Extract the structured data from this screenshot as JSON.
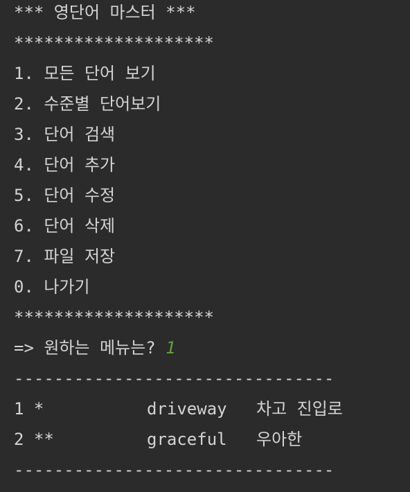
{
  "console": {
    "header_title": "*** 영단어 마스터 ***",
    "stars_top": "********************",
    "menu": [
      "1. 모든 단어 보기",
      "2. 수준별 단어보기",
      "3. 단어 검색",
      "4. 단어 추가",
      "5. 단어 수정",
      "6. 단어 삭제",
      "7. 파일 저장",
      "0. 나가기"
    ],
    "stars_bottom": "********************",
    "prompt": "=> 원하는 메뉴는? ",
    "input_value": "1",
    "divider_top": "--------------------------------",
    "words": [
      {
        "index_level": "1 *",
        "word": "driveway",
        "meaning": "차고 진입로"
      },
      {
        "index_level": "2 **",
        "word": "graceful",
        "meaning": "우아한"
      }
    ],
    "divider_bottom": "--------------------------------"
  },
  "colors": {
    "background": "#2b2b2b",
    "text": "#d4d4d4",
    "input": "#5fa33a"
  }
}
